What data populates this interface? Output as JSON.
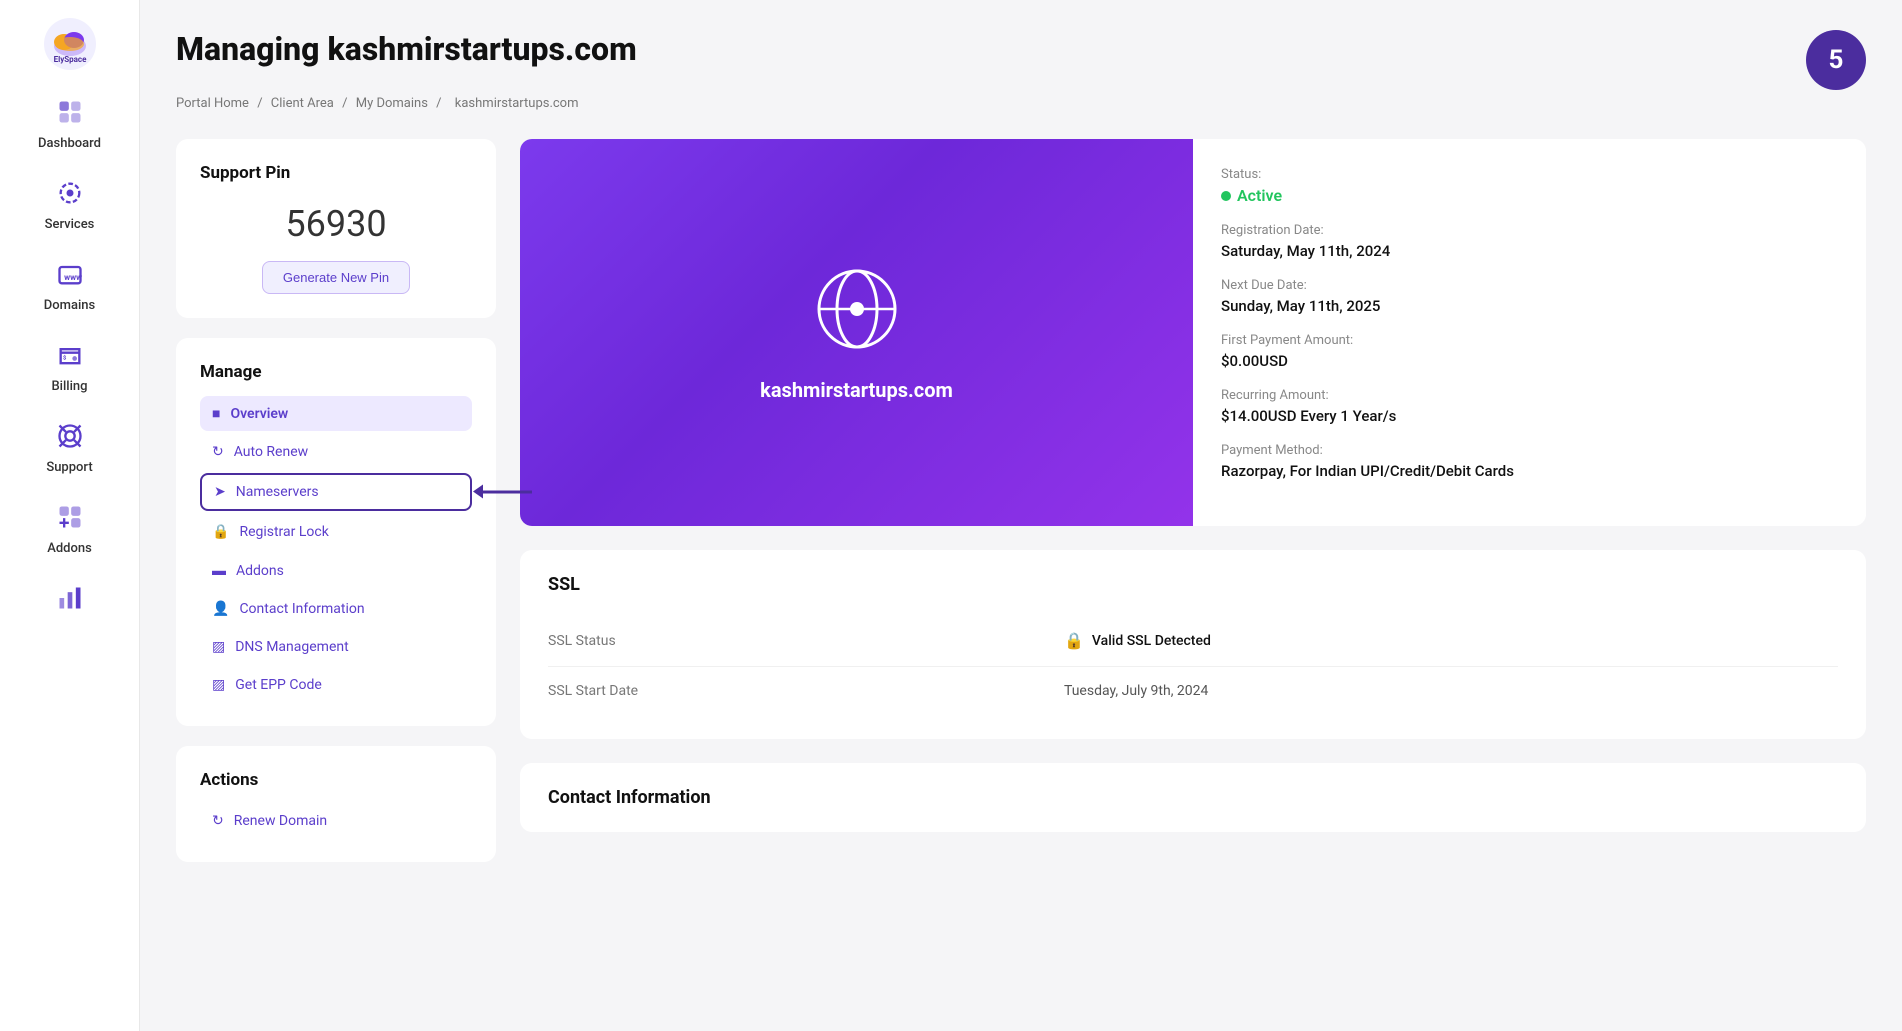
{
  "sidebar": {
    "logo_alt": "ElySpace",
    "items": [
      {
        "id": "dashboard",
        "label": "Dashboard"
      },
      {
        "id": "services",
        "label": "Services"
      },
      {
        "id": "domains",
        "label": "Domains"
      },
      {
        "id": "billing",
        "label": "Billing"
      },
      {
        "id": "support",
        "label": "Support"
      },
      {
        "id": "addons",
        "label": "Addons"
      },
      {
        "id": "stats",
        "label": ""
      }
    ]
  },
  "header": {
    "title": "Managing kashmirstartups.com",
    "notification_count": "5"
  },
  "breadcrumb": {
    "items": [
      "Portal Home",
      "Client Area",
      "My Domains",
      "kashmirstartups.com"
    ]
  },
  "support_pin": {
    "label": "Support Pin",
    "pin": "56930",
    "button_label": "Generate New Pin"
  },
  "manage": {
    "label": "Manage",
    "items": [
      {
        "id": "overview",
        "label": "Overview",
        "active": true
      },
      {
        "id": "auto-renew",
        "label": "Auto Renew",
        "active": false
      },
      {
        "id": "nameservers",
        "label": "Nameservers",
        "active": false,
        "highlighted": true
      },
      {
        "id": "registrar-lock",
        "label": "Registrar Lock",
        "active": false
      },
      {
        "id": "addons",
        "label": "Addons",
        "active": false
      },
      {
        "id": "contact-info",
        "label": "Contact Information",
        "active": false
      },
      {
        "id": "dns-management",
        "label": "DNS Management",
        "active": false
      },
      {
        "id": "get-epp",
        "label": "Get EPP Code",
        "active": false
      }
    ]
  },
  "actions": {
    "label": "Actions",
    "items": [
      {
        "id": "renew",
        "label": "Renew Domain"
      }
    ]
  },
  "domain": {
    "name": "kashmirstartups.com"
  },
  "domain_details": {
    "status_label": "Status:",
    "status_value": "Active",
    "registration_label": "Registration Date:",
    "registration_value": "Saturday, May 11th, 2024",
    "next_due_label": "Next Due Date:",
    "next_due_value": "Sunday, May 11th, 2025",
    "first_payment_label": "First Payment Amount:",
    "first_payment_value": "$0.00USD",
    "recurring_label": "Recurring Amount:",
    "recurring_value": "$14.00USD Every 1 Year/s",
    "payment_method_label": "Payment Method:",
    "payment_method_value": "Razorpay, For Indian UPI/Credit/Debit Cards"
  },
  "ssl": {
    "label": "SSL",
    "status_label": "SSL Status",
    "status_value": "Valid SSL Detected",
    "start_date_label": "SSL Start Date",
    "start_date_value": "Tuesday, July 9th, 2024"
  },
  "contact_information": {
    "label": "Contact Information"
  }
}
